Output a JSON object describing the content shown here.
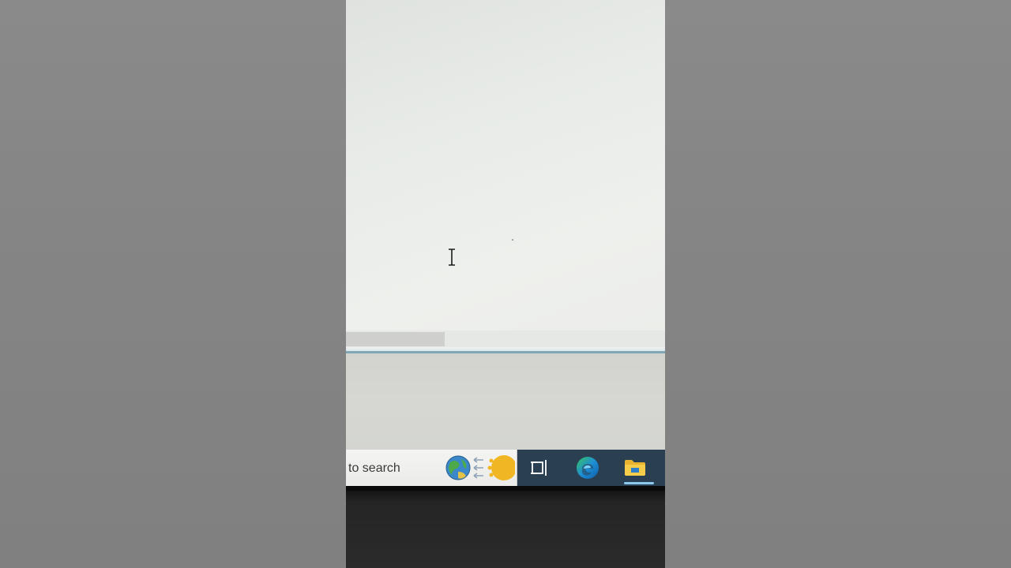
{
  "taskbar": {
    "search_placeholder": "to search",
    "icons": {
      "search_highlight": "globe-weather-icon",
      "task_view": "task-view-icon",
      "edge": "edge-browser-icon",
      "explorer": "file-explorer-icon"
    },
    "active_app": "file-explorer"
  },
  "cursor": {
    "type": "text-cursor-icon"
  },
  "colors": {
    "taskbar_bg": "#2a3f52",
    "search_bg": "#f4f4f2",
    "accent_indicator": "#8cc7ef",
    "sun": "#f1b624",
    "folder": "#e9b22f",
    "edge_blue": "#1f8fd6",
    "edge_green": "#37c45a"
  }
}
